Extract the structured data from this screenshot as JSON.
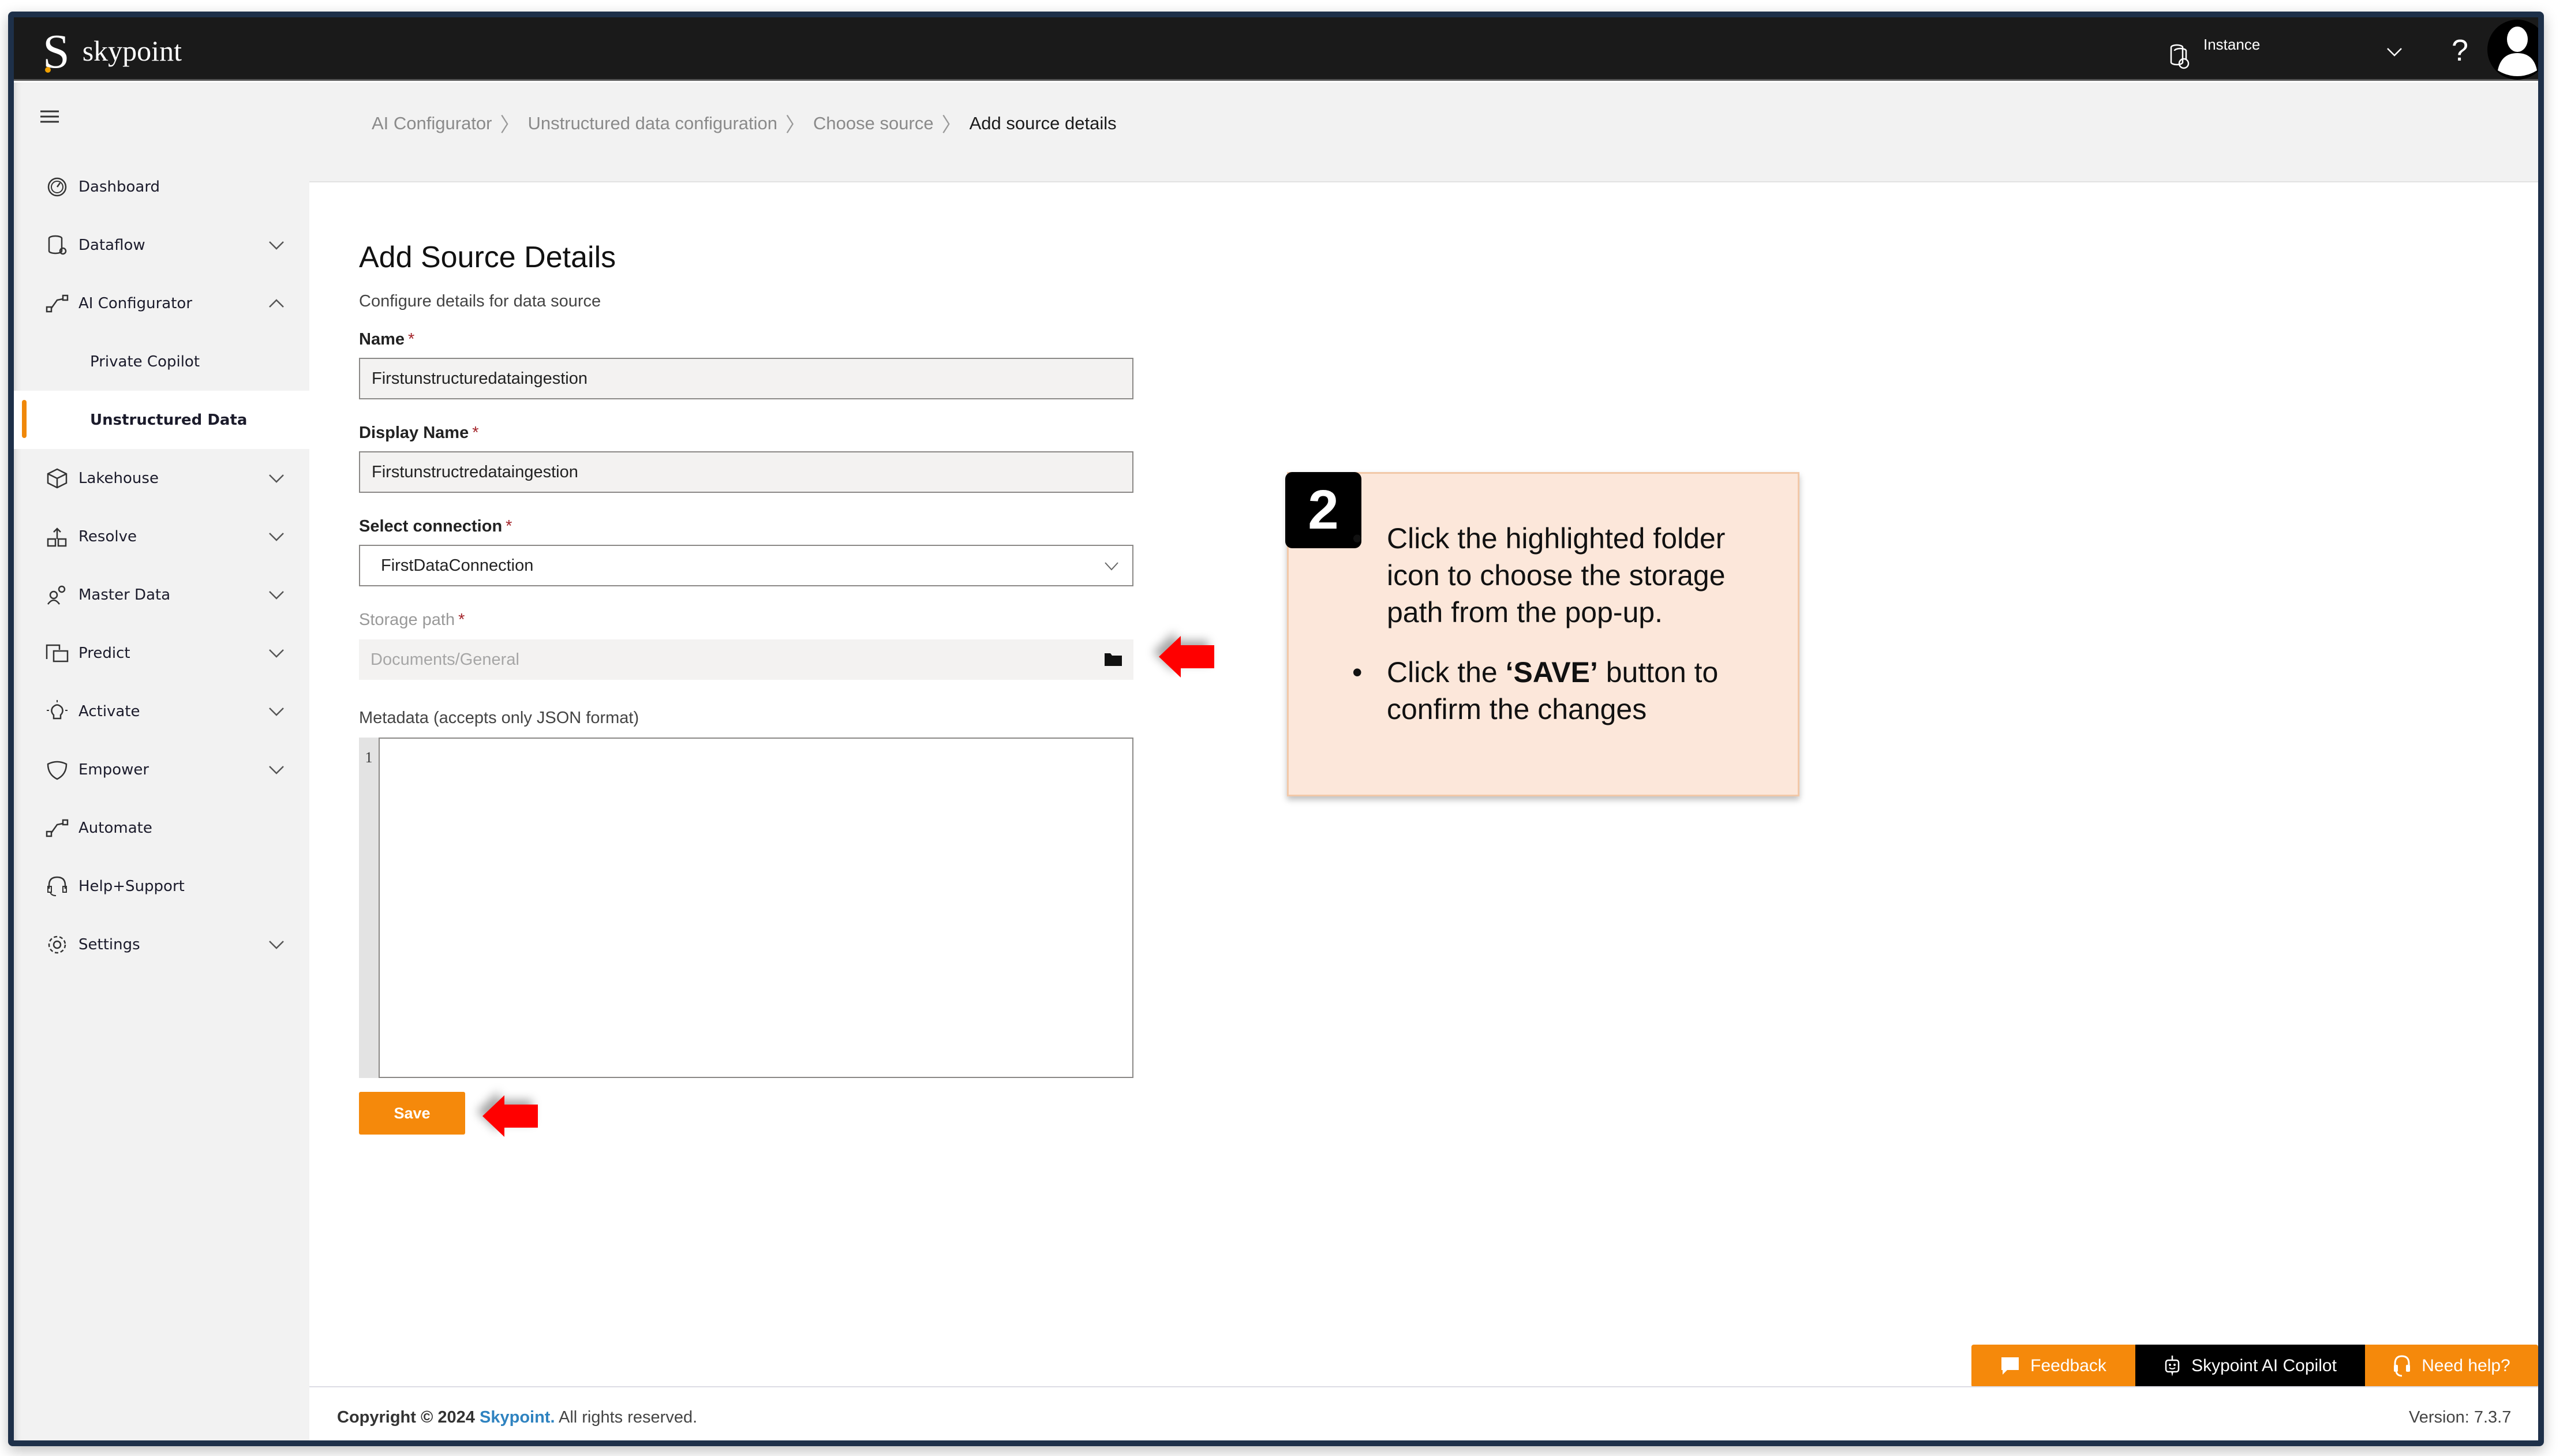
{
  "app": {
    "brand": "skypoint",
    "instance_label": "Instance",
    "help_glyph": "?"
  },
  "sidebar": {
    "items": [
      {
        "label": "Dashboard",
        "icon": "dashboard-gauge-icon",
        "expandable": false
      },
      {
        "label": "Dataflow",
        "icon": "database-gear-icon",
        "expandable": true,
        "expanded": false
      },
      {
        "label": "AI Configurator",
        "icon": "flow-nodes-icon",
        "expandable": true,
        "expanded": true
      },
      {
        "label": "Private Copilot",
        "sub": true
      },
      {
        "label": "Unstructured Data",
        "sub": true,
        "active": true
      },
      {
        "label": "Lakehouse",
        "icon": "cube-icon",
        "expandable": true,
        "expanded": false
      },
      {
        "label": "Resolve",
        "icon": "hierarchy-icon",
        "expandable": true,
        "expanded": false
      },
      {
        "label": "Master Data",
        "icon": "people-icon",
        "expandable": true,
        "expanded": false
      },
      {
        "label": "Predict",
        "icon": "windows-icon",
        "expandable": true,
        "expanded": false
      },
      {
        "label": "Activate",
        "icon": "lightbulb-icon",
        "expandable": true,
        "expanded": false
      },
      {
        "label": "Empower",
        "icon": "shield-icon",
        "expandable": true,
        "expanded": false
      },
      {
        "label": "Automate",
        "icon": "flow-nodes-icon",
        "expandable": false
      },
      {
        "label": "Help+Support",
        "icon": "headset-icon",
        "expandable": false
      },
      {
        "label": "Settings",
        "icon": "gear-icon",
        "expandable": true,
        "expanded": false
      }
    ]
  },
  "breadcrumb": [
    "AI Configurator",
    "Unstructured data configuration",
    "Choose source",
    "Add source details"
  ],
  "form": {
    "title": "Add Source Details",
    "subtitle": "Configure details for data source",
    "name": {
      "label": "Name",
      "required": "*",
      "value": "Firstunstructuredataingestion"
    },
    "display_name": {
      "label": "Display Name",
      "required": "*",
      "value": "Firstunstructredataingestion"
    },
    "connection": {
      "label": "Select connection",
      "required": "*",
      "value": "FirstDataConnection"
    },
    "storage_path": {
      "label": "Storage path",
      "required": "*",
      "placeholder": "Documents/General"
    },
    "metadata": {
      "label": "Metadata (accepts only JSON format)",
      "line_number": "1",
      "value": ""
    },
    "save_label": "Save"
  },
  "callout": {
    "step": "2",
    "bullet1": "Click the highlighted folder icon to choose the storage path from the pop-up.",
    "bullet2_pre": "Click the ",
    "bullet2_bold": "‘SAVE’",
    "bullet2_post": " button to confirm the changes"
  },
  "footer": {
    "feedback": "Feedback",
    "copilot": "Skypoint AI Copilot",
    "need_help": "Need help?",
    "copyright_pre": "Copyright © 2024",
    "copyright_brand": "Skypoint.",
    "copyright_post": "All rights reserved.",
    "version": "Version: 7.3.7"
  },
  "colors": {
    "accent": "#f5890b",
    "frame": "#1e3049",
    "header": "#1a1a1a",
    "callout_bg": "#fce7da",
    "annotation_arrow": "#ff0000",
    "brand_link": "#2f83c0"
  }
}
